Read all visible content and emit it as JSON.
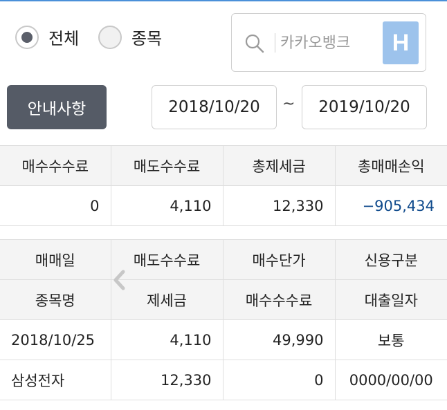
{
  "filter": {
    "options": [
      {
        "label": "전체",
        "selected": true
      },
      {
        "label": "종목",
        "selected": false
      }
    ]
  },
  "search": {
    "placeholder": "카카오뱅크",
    "button_label": "H",
    "icon": "search-icon"
  },
  "notice_button": "안내사항",
  "date_range": {
    "from": "2018/10/20",
    "separator": "~",
    "to": "2019/10/20"
  },
  "summary": {
    "headers": [
      "매수수수료",
      "매도수수료",
      "총제세금",
      "총매매손익"
    ],
    "values": [
      "0",
      "4,110",
      "12,330",
      "−905,434"
    ]
  },
  "detail": {
    "headers_row1": [
      "매매일",
      "매도수수료",
      "매수단가",
      "신용구분"
    ],
    "headers_row2": [
      "종목명",
      "제세금",
      "매수수수료",
      "대출일자"
    ],
    "rows": [
      [
        "2018/10/25",
        "4,110",
        "49,990",
        "보통"
      ],
      [
        "삼성전자",
        "12,330",
        "0",
        "0000/00/00"
      ]
    ]
  },
  "colors": {
    "accent": "#4a90d9",
    "negative": "#0f4a8c",
    "button_dark": "#555b66",
    "h_button": "#9dc3ec"
  }
}
